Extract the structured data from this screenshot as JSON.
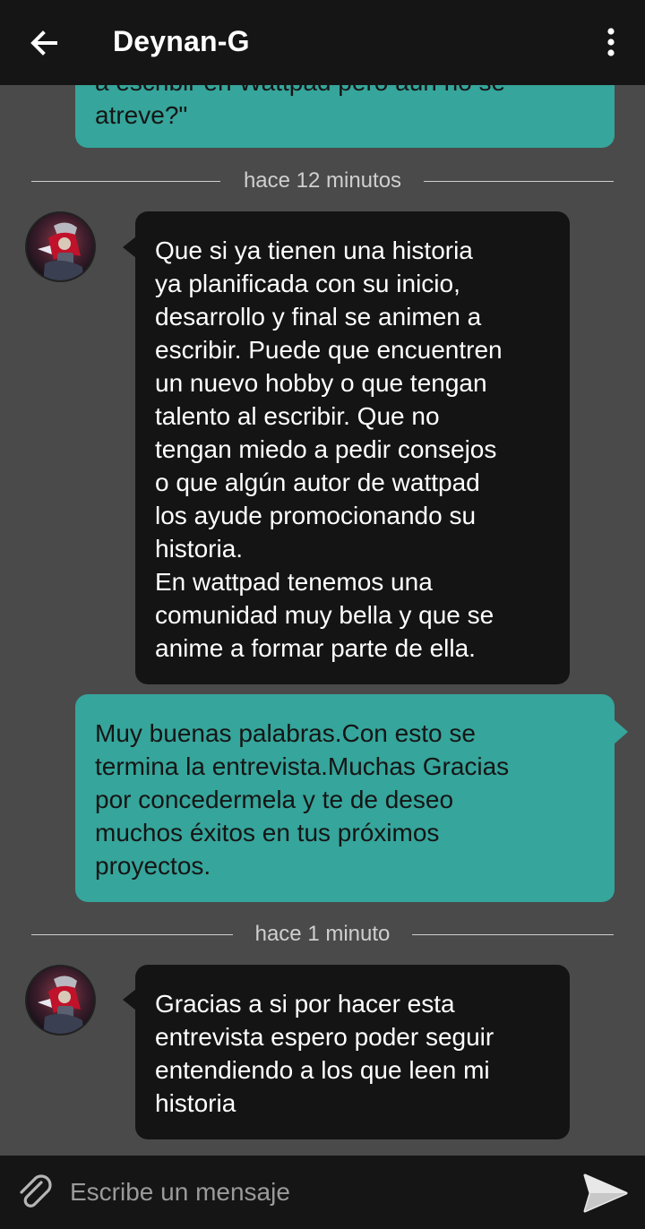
{
  "header": {
    "title": "Deynan-G",
    "back_icon": "arrow-left-icon",
    "menu_icon": "more-vertical-icon"
  },
  "messages": [
    {
      "direction": "outgoing",
      "text": "a escribir en Wattpad pero aún no se\natreve?\""
    },
    {
      "timestamp": "hace 12 minutos"
    },
    {
      "direction": "incoming",
      "text": "Que si ya tienen una historia\nya planificada con su inicio,\ndesarrollo y final se animen a\nescribir. Puede que encuentren\nun nuevo hobby o que tengan\ntalento al escribir. Que no\ntengan miedo a pedir consejos\no que algún autor de wattpad\nlos ayude promocionando su\nhistoria.\nEn wattpad tenemos una\ncomunidad muy bella y que se\nanime a formar parte de ella."
    },
    {
      "direction": "outgoing",
      "text": "Muy buenas palabras.Con esto se\ntermina la entrevista.Muchas Gracias\npor concedermela y te de deseo\nmuchos éxitos en tus próximos\nproyectos."
    },
    {
      "timestamp": "hace 1 minuto"
    },
    {
      "direction": "incoming",
      "text": "Gracias a si por hacer esta\nentrevista espero poder seguir\nentendiendo a los que leen mi\nhistoria"
    }
  ],
  "composer": {
    "placeholder": "Escribe un mensaje",
    "attach_icon": "paperclip-icon",
    "send_icon": "send-icon"
  },
  "colors": {
    "app_bar": "#151515",
    "background": "#4a4a4a",
    "outgoing_bubble": "#36a59b",
    "incoming_bubble": "#141414"
  }
}
